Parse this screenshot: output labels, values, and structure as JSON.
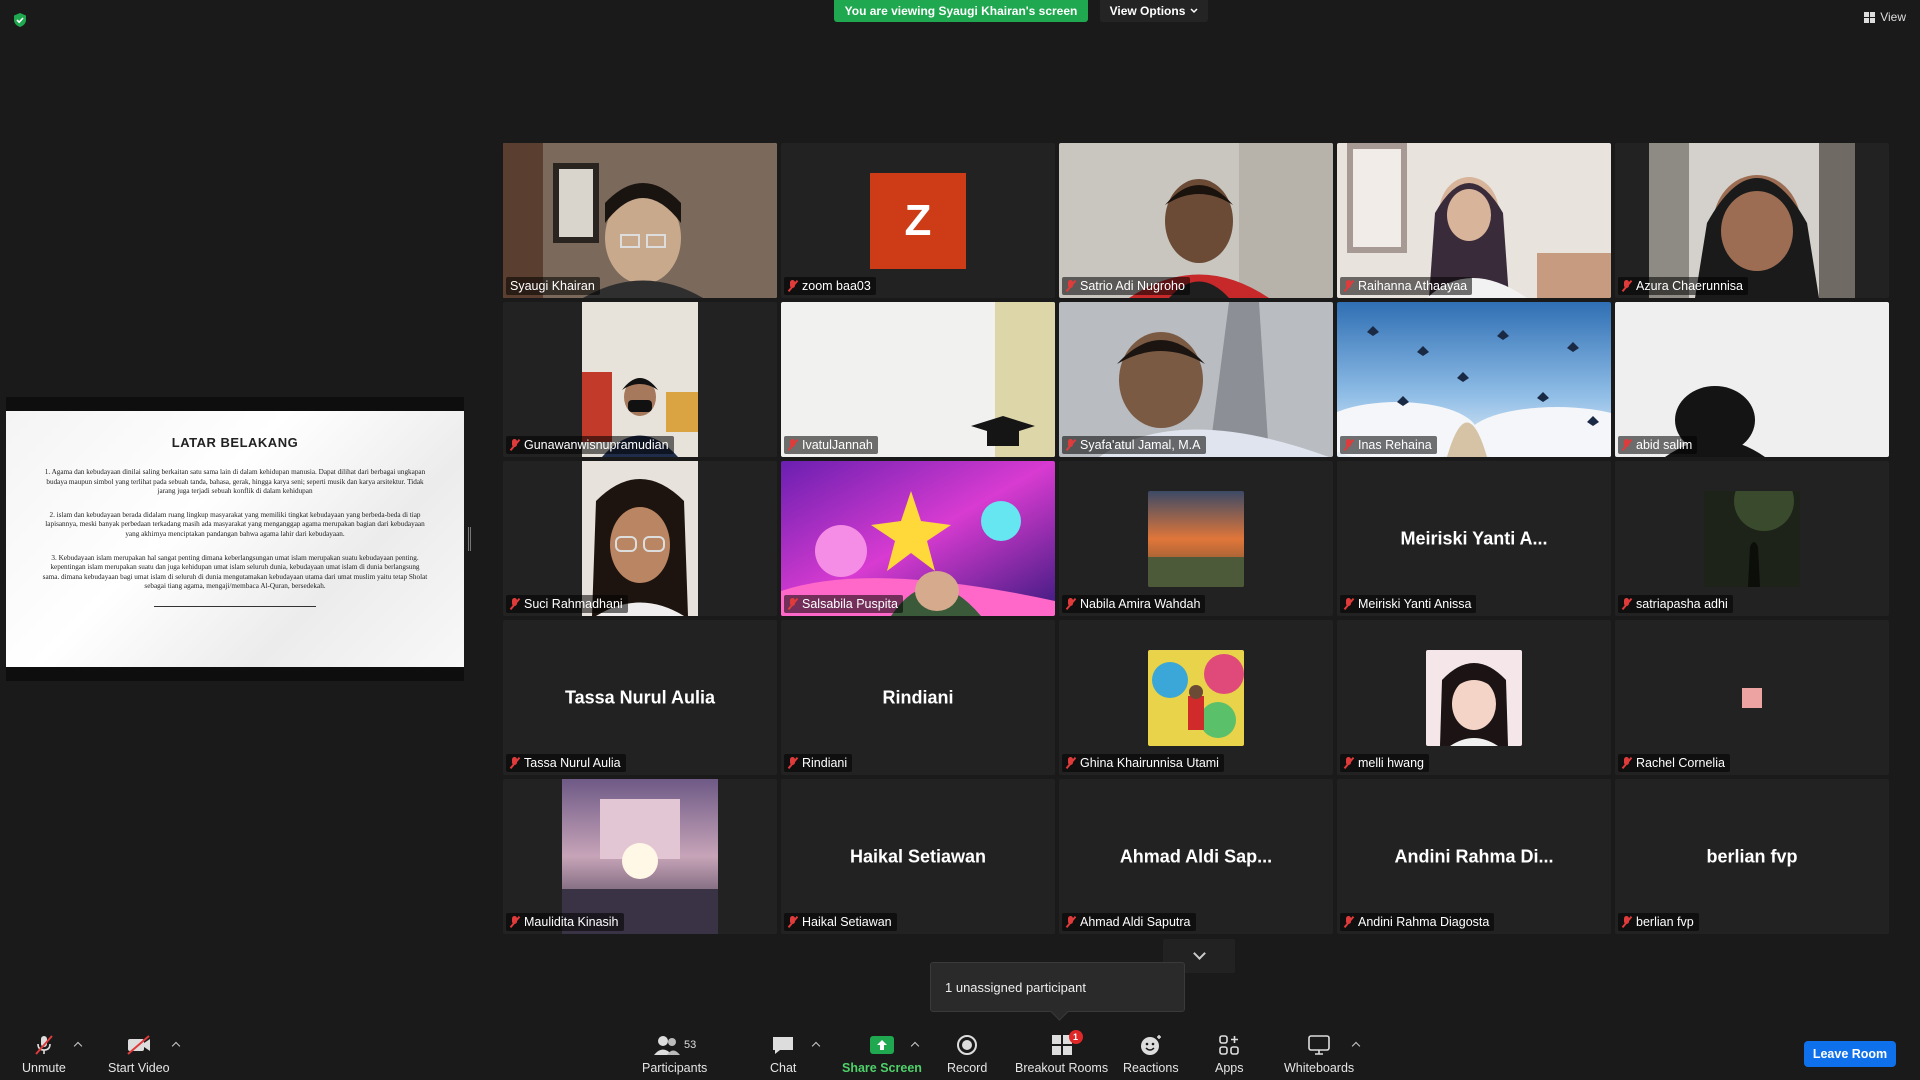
{
  "header": {
    "viewing_banner": "You are viewing Syaugi Khairan's screen",
    "view_options": "View Options",
    "view": "View"
  },
  "shared_screen": {
    "slide_title": "LATAR BELAKANG",
    "paragraphs": [
      "1.   Agama dan kebudayaan dinilai saling berkaitan satu sama lain di dalam kehidupan manusia. Dapat dilihat dari berbagai ungkapan budaya maupun simbol yang terlihat pada sebuah tanda, bahasa, gerak, hingga karya seni; seperti musik dan karya arsitektur. Tidak jarang juga terjadi sebuah konflik di dalam kehidupan",
      "2. islam dan kebudayaan berada didalam ruang lingkup masyarakat yang memiliki tingkat kebudayaan yang berbeda-beda di tiap lapisannya, meski banyak perbedaan terkadang masih ada masyarakat yang menganggap agama merupakan bagian dari kebudayaan yang akhirnya menciptakan pandangan bahwa agama lahir dari kebudayaan.",
      "3.  Kebudayaan islam merupakan hal sangat penting dimana keberlangsungan umat islam merupakan suatu kebudayaan penting. kepentingan islam merupakan suatu dan juga kehidupan umat islam seluruh dunia, kebudayaan umat islam di dunia berlangsung sama. dimana kebudayaan bagi umat islam di seluruh di dunia mengutamakan kebudayaan utama dari umat muslim yaitu tetap Sholat sebagai tiang agama, mengaji/membaca Al-Quran, bersedekah."
    ]
  },
  "participants": [
    {
      "name": "Syaugi Khairan",
      "video": "room",
      "active": true,
      "muted": false
    },
    {
      "name": "zoom baa03",
      "video": "z-avatar",
      "initial": "Z",
      "muted": true
    },
    {
      "name": "Satrio Adi Nugroho",
      "video": "room",
      "muted": true
    },
    {
      "name": "Raihanna Athaayaa",
      "video": "room",
      "muted": true
    },
    {
      "name": "Azura Chaerunnisa",
      "video": "room",
      "muted": true
    },
    {
      "name": "Gunawanwisnupramudian",
      "video": "room",
      "muted": true
    },
    {
      "name": "IvatulJannah",
      "video": "room",
      "muted": true
    },
    {
      "name": "Syafa'atul Jamal, M.A",
      "video": "room",
      "muted": true
    },
    {
      "name": "Inas Rehaina",
      "video": "sky",
      "muted": true
    },
    {
      "name": "abid salim",
      "video": "room",
      "muted": true
    },
    {
      "name": "Suci Rahmadhani",
      "video": "room",
      "muted": true
    },
    {
      "name": "Salsabila Puspita",
      "video": "colorful",
      "muted": true
    },
    {
      "name": "Nabila Amira Wahdah",
      "video": "avatar-photo",
      "muted": true
    },
    {
      "name": "Meiriski Yanti Anissa",
      "display": "Meiriski Yanti A...",
      "video": "none",
      "muted": true
    },
    {
      "name": "satriapasha adhi",
      "video": "avatar-photo",
      "muted": true
    },
    {
      "name": "Tassa Nurul Aulia",
      "display": "Tassa Nurul Aulia",
      "video": "none",
      "muted": true
    },
    {
      "name": "Rindiani",
      "display": "Rindiani",
      "video": "none",
      "muted": true
    },
    {
      "name": "Ghina Khairunnisa Utami",
      "video": "avatar-photo",
      "muted": true
    },
    {
      "name": "melli hwang",
      "video": "avatar-photo",
      "muted": true
    },
    {
      "name": "Rachel Cornelia",
      "video": "pink-dot",
      "muted": true
    },
    {
      "name": "Maulidita Kinasih",
      "video": "moon",
      "muted": true
    },
    {
      "name": "Haikal Setiawan",
      "display": "Haikal Setiawan",
      "video": "none",
      "muted": true
    },
    {
      "name": "Ahmad Aldi Saputra",
      "display": "Ahmad  Aldi  Sap...",
      "video": "none",
      "muted": true
    },
    {
      "name": "Andini Rahma Diagosta",
      "display": "Andini  Rahma  Di...",
      "video": "none",
      "muted": true
    },
    {
      "name": "berlian fvp",
      "display": "berlian fvp",
      "video": "none",
      "muted": true
    }
  ],
  "unassigned_popup": "1 unassigned participant",
  "toolbar": {
    "unmute": "Unmute",
    "start_video": "Start Video",
    "participants": "Participants",
    "participants_count": "53",
    "chat": "Chat",
    "share_screen": "Share Screen",
    "record": "Record",
    "breakout_rooms": "Breakout Rooms",
    "breakout_badge": "1",
    "reactions": "Reactions",
    "apps": "Apps",
    "whiteboards": "Whiteboards",
    "leave_room": "Leave Room"
  },
  "colors": {
    "banner_green": "#1fa84f",
    "active_speaker": "#e6e84a",
    "muted_red": "#e03b3b",
    "leave_blue": "#0e71eb",
    "z_avatar": "#cd3c17"
  }
}
